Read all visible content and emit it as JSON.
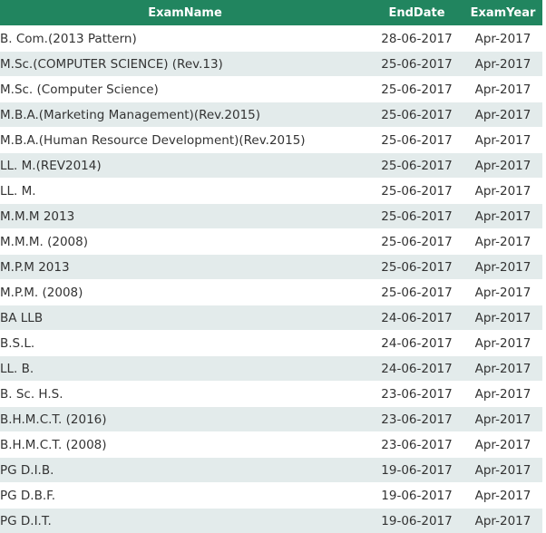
{
  "table": {
    "headers": {
      "exam_name": "ExamName",
      "end_date": "EndDate",
      "exam_year": "ExamYear"
    },
    "rows": [
      {
        "exam_name": "B. Com.(2013 Pattern)",
        "end_date": "28-06-2017",
        "exam_year": "Apr-2017"
      },
      {
        "exam_name": "M.Sc.(COMPUTER SCIENCE) (Rev.13)",
        "end_date": "25-06-2017",
        "exam_year": "Apr-2017"
      },
      {
        "exam_name": "M.Sc. (Computer Science)",
        "end_date": "25-06-2017",
        "exam_year": "Apr-2017"
      },
      {
        "exam_name": "M.B.A.(Marketing Management)(Rev.2015)",
        "end_date": "25-06-2017",
        "exam_year": "Apr-2017"
      },
      {
        "exam_name": "M.B.A.(Human Resource Development)(Rev.2015)",
        "end_date": "25-06-2017",
        "exam_year": "Apr-2017"
      },
      {
        "exam_name": "LL. M.(REV2014)",
        "end_date": "25-06-2017",
        "exam_year": "Apr-2017"
      },
      {
        "exam_name": "LL. M.",
        "end_date": "25-06-2017",
        "exam_year": "Apr-2017"
      },
      {
        "exam_name": "M.M.M 2013",
        "end_date": "25-06-2017",
        "exam_year": "Apr-2017"
      },
      {
        "exam_name": "M.M.M. (2008)",
        "end_date": "25-06-2017",
        "exam_year": "Apr-2017"
      },
      {
        "exam_name": "M.P.M 2013",
        "end_date": "25-06-2017",
        "exam_year": "Apr-2017"
      },
      {
        "exam_name": "M.P.M. (2008)",
        "end_date": "25-06-2017",
        "exam_year": "Apr-2017"
      },
      {
        "exam_name": "BA LLB",
        "end_date": "24-06-2017",
        "exam_year": "Apr-2017"
      },
      {
        "exam_name": "B.S.L.",
        "end_date": "24-06-2017",
        "exam_year": "Apr-2017"
      },
      {
        "exam_name": "LL. B.",
        "end_date": "24-06-2017",
        "exam_year": "Apr-2017"
      },
      {
        "exam_name": "B. Sc. H.S.",
        "end_date": "23-06-2017",
        "exam_year": "Apr-2017"
      },
      {
        "exam_name": "B.H.M.C.T. (2016)",
        "end_date": "23-06-2017",
        "exam_year": "Apr-2017"
      },
      {
        "exam_name": "B.H.M.C.T. (2008)",
        "end_date": "23-06-2017",
        "exam_year": "Apr-2017"
      },
      {
        "exam_name": "PG D.I.B.",
        "end_date": "19-06-2017",
        "exam_year": "Apr-2017"
      },
      {
        "exam_name": "PG D.B.F.",
        "end_date": "19-06-2017",
        "exam_year": "Apr-2017"
      },
      {
        "exam_name": "PG D.I.T.",
        "end_date": "19-06-2017",
        "exam_year": "Apr-2017"
      }
    ]
  },
  "colors": {
    "header_bg": "#21855f",
    "stripe_bg": "#e3ebeb"
  }
}
